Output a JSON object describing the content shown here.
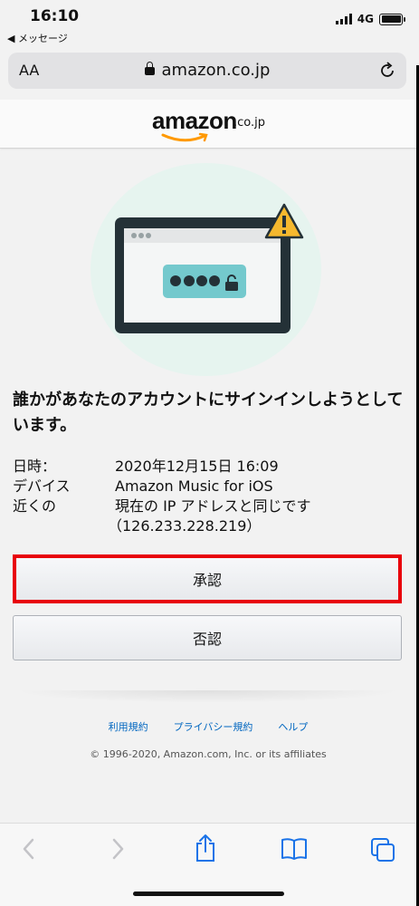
{
  "status_bar": {
    "time": "16:10",
    "back_label": "◀ メッセージ",
    "network": "4G"
  },
  "address_bar": {
    "text_size_label": "AA",
    "url": "amazon.co.jp"
  },
  "header": {
    "logo_text": "amazon",
    "logo_tld": ".co.jp"
  },
  "icons": {
    "lock": "lock-icon",
    "reload": "reload-icon",
    "warning": "warning-icon",
    "back": "chevron-left-icon",
    "forward": "chevron-right-icon",
    "share": "share-icon",
    "bookmarks": "book-icon",
    "tabs": "tabs-icon"
  },
  "message": {
    "heading": "誰かがあなたのアカウントにサインインしようとしています。",
    "rows": [
      {
        "label": "日時：",
        "value": "2020年12月15日 16:09"
      },
      {
        "label": "デバイス",
        "value": "Amazon Music for iOS"
      },
      {
        "label": "近くの",
        "value": "現在の IP アドレスと同じです"
      }
    ],
    "ip": "（126.233.228.219）"
  },
  "buttons": {
    "approve": "承認",
    "deny": "否認"
  },
  "footer": {
    "links": [
      "利用規約",
      "プライバシー規約",
      "ヘルプ"
    ],
    "copyright": "© 1996-2020, Amazon.com, Inc. or its affiliates"
  },
  "colors": {
    "highlight": "#e8000b",
    "link": "#0066c0",
    "smile": "#ff9900",
    "warning": "#f5b82e"
  }
}
